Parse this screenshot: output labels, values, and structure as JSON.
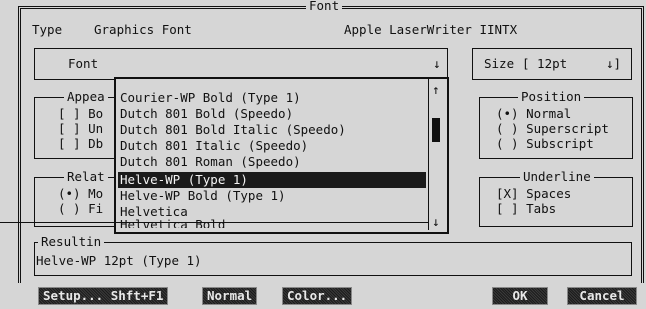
{
  "dialog": {
    "title": "Font",
    "type_label": "Type",
    "type_value": "Graphics Font",
    "printer": "Apple LaserWriter IINTX"
  },
  "font_field": {
    "label": "Font",
    "arrow": "↓"
  },
  "size_field": {
    "label": "Size",
    "value": "[ 12pt",
    "arrow": "↓]"
  },
  "appearance": {
    "title": "Appea",
    "items": [
      "[ ] Bo",
      "[ ] Un",
      "[ ] Db"
    ]
  },
  "relative": {
    "title": "Relat",
    "items": [
      "(•) Mo",
      "( ) Fi"
    ]
  },
  "position": {
    "title": "Position",
    "items": [
      "(•) Normal",
      "( ) Superscript",
      "( ) Subscript"
    ]
  },
  "underline": {
    "title": "Underline",
    "items": [
      "[X] Spaces",
      "[ ] Tabs"
    ]
  },
  "font_list": {
    "items": [
      "Courier-WP Bold (Type 1)",
      "Dutch 801 Bold (Speedo)",
      "Dutch 801 Bold Italic (Speedo)",
      "Dutch 801 Italic (Speedo)",
      "Dutch 801 Roman (Speedo)",
      "Helve-WP (Type 1)",
      "Helve-WP Bold (Type 1)",
      "Helvetica",
      "Helvetica Bold"
    ],
    "selected_index": 5,
    "up_arrow": "↑",
    "down_arrow": "↓"
  },
  "result": {
    "title": "Resultin",
    "text": "Helve-WP 12pt (Type 1)"
  },
  "buttons": {
    "setup": "Setup... Shft+F1",
    "normal": "Normal",
    "color": "Color...",
    "ok": "OK",
    "cancel": "Cancel"
  }
}
